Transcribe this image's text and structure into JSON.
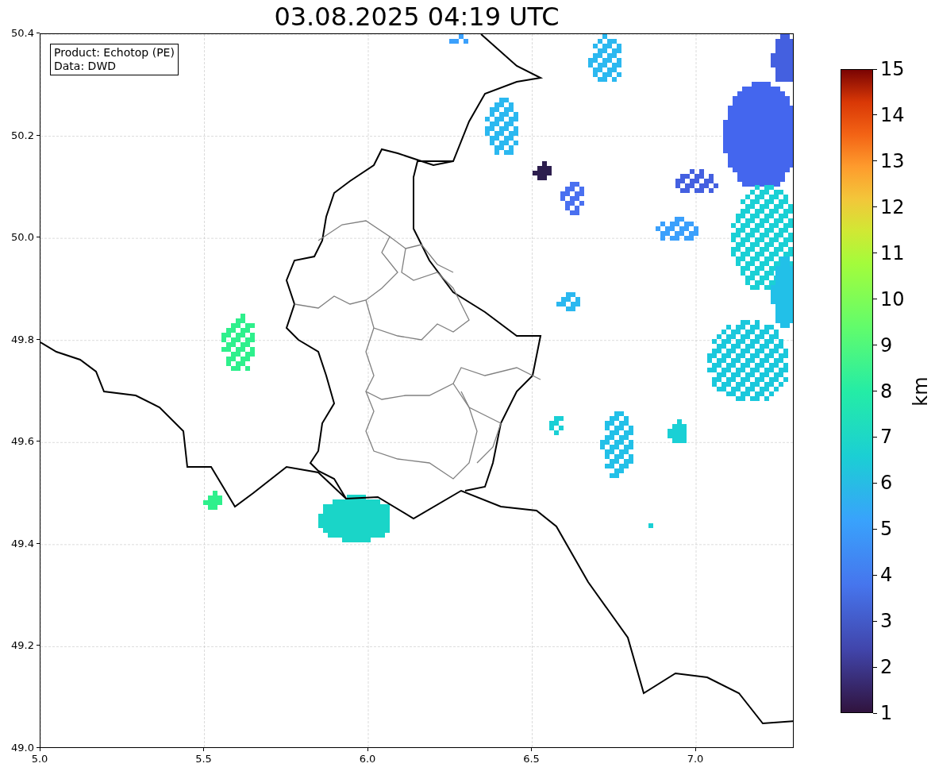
{
  "title": "03.08.2025 04:19 UTC",
  "legend": [
    "Product: Echotop (PE)",
    "Data: DWD"
  ],
  "x_ticks": [
    "5.0",
    "5.5",
    "6.0",
    "6.5",
    "7.0"
  ],
  "y_ticks": [
    "50.4",
    "50.2",
    "50.0",
    "49.8",
    "49.6",
    "49.4",
    "49.2",
    "49.0"
  ],
  "colorbar": {
    "label": "km",
    "ticks": [
      "15",
      "14",
      "13",
      "12",
      "11",
      "10",
      "9",
      "8",
      "7",
      "6",
      "5",
      "4",
      "3",
      "2",
      "1"
    ]
  }
}
